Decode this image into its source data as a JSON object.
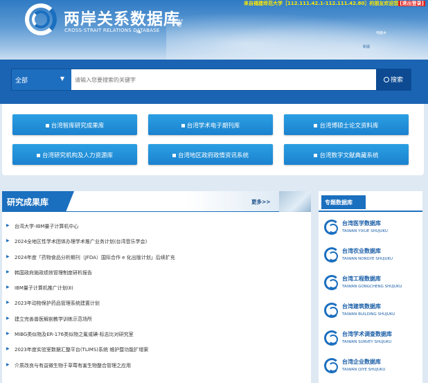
{
  "header": {
    "title": "两岸关系数据库",
    "subtitle": "CROSS-STRAIT RELATIONS DATABASE",
    "topbar_text": "来自福建师范大学［112.111.42.1-112.111.42.80］的朋友欢迎您",
    "logout_label": "[退出登录]",
    "mini_text_1": "电脑木",
    "mini_text_2": "新疆"
  },
  "search": {
    "scope_selected": "全部",
    "placeholder": "请输入您要搜索的关键字",
    "button_label": "搜索"
  },
  "quick_links": [
    "台湾智库研究成果库",
    "台湾学术电子期刊库",
    "台湾博硕士论文资料库",
    "台湾研究机构及人力资源库",
    "台湾地区政府政情资讯系统",
    "台湾数字文献典藏系统"
  ],
  "research": {
    "title": "研究成果库",
    "more_label": "更多>>",
    "items": [
      "台湾大学-IBM量子计算机中心",
      "2024全地区性学术团体办理学术推广业务计划(台湾音乐学会)",
      "2024年度「药物食品分析期刊（JFDA）国际合作 e 化出版计划」后续扩充",
      "韩国政府施政绩效管理制度研析报告",
      "IBM量子计算机推广计划(Ⅱ)",
      "2023年动物保护药品管理系统建置计划",
      "建立完善兽医解剖教学训练示范场所",
      "MIBG类似物及ER-176类似物之氟或碘-标志比对研究室",
      "2023年度实验室数据汇整平台(TLIMS)系统 维护暨功能扩增案",
      "介质改良与有益微生物于草莓有害生物整合管理之应用"
    ]
  },
  "special": {
    "title": "专题数据库",
    "items": [
      {
        "cn": "台湾医学数据库",
        "en": "TAIWAN YIXUE SHUJUKU"
      },
      {
        "cn": "台湾农业数据库",
        "en": "TAIWAN NONGYE SHUJUKU"
      },
      {
        "cn": "台湾工程数据库",
        "en": "TAIWAN GONGCHENG SHUJUKU"
      },
      {
        "cn": "台湾建筑数据库",
        "en": "TAIWAN BUILDING SHUJUKU"
      },
      {
        "cn": "台湾学术调查数据库",
        "en": "TAIWAN SURVEY SHUJUKU"
      },
      {
        "cn": "台湾企业数据库",
        "en": "TAIWAN QIYE SHUJUKU"
      }
    ]
  },
  "colors": {
    "primary_blue": "#1b6fbf",
    "button_blue": "#2b9fe3",
    "topbar_yellow": "#ffea00",
    "logout_red": "#e0201b"
  }
}
